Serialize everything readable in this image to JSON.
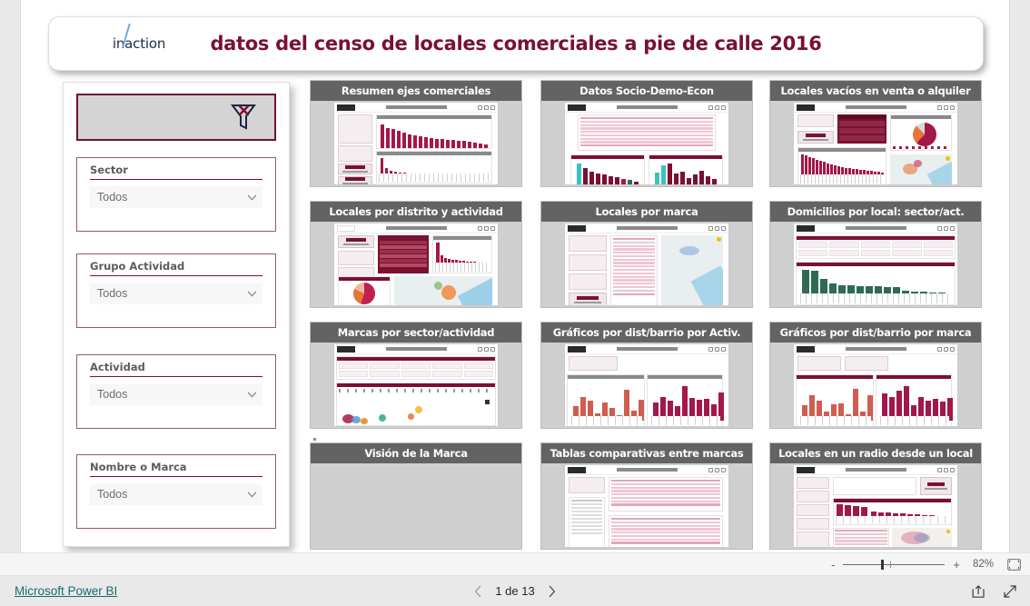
{
  "report": {
    "logo_text": "inaction",
    "title": "datos del censo de locales comerciales a pie de calle 2016",
    "accent_color": "#7b1030",
    "header_color": "#636363"
  },
  "filters": {
    "clear_button_label": "",
    "clear_icon": "funnel-clear-icon",
    "slicers": [
      {
        "label": "Sector",
        "value": "Todos",
        "icon": "chevron-down-icon"
      },
      {
        "label": "Grupo Actividad",
        "value": "Todos",
        "icon": "chevron-down-icon"
      },
      {
        "label": "Actividad",
        "value": "Todos",
        "icon": "chevron-down-icon"
      },
      {
        "label": "Nombre o Marca",
        "value": "Todos",
        "icon": "chevron-down-icon"
      }
    ]
  },
  "cards": [
    {
      "title": "Resumen ejes comerciales",
      "thumb": "bars-descending"
    },
    {
      "title": "Datos Socio-Demo-Econ",
      "thumb": "table-and-two-bar-charts"
    },
    {
      "title": "Locales vacíos en venta o alquiler",
      "thumb": "kpi-pie-bars-map"
    },
    {
      "title": "Locales por distrito y actividad",
      "thumb": "kpi-list-bars-pie-map"
    },
    {
      "title": "Locales por marca",
      "thumb": "slicers-list-map"
    },
    {
      "title": "Domicilios por local: sector/act.",
      "thumb": "green-bars"
    },
    {
      "title": "Marcas por sector/actividad",
      "thumb": "scatter-bubbles"
    },
    {
      "title": "Gráficos por dist/barrio por Activ.",
      "thumb": "two-bar-charts"
    },
    {
      "title": "Gráficos por dist/barrio por marca",
      "thumb": "two-bar-charts-alt"
    },
    {
      "title": "Visión de la Marca",
      "thumb": "empty"
    },
    {
      "title": "Tablas comparativas entre marcas",
      "thumb": "two-tables"
    },
    {
      "title": "Locales en un radio desde un local",
      "thumb": "slicers-bars-table-map"
    }
  ],
  "zoom_bar": {
    "minus_label": "-",
    "plus_label": "+",
    "percent": "82%",
    "fit_icon": "fit-to-page-icon"
  },
  "footer": {
    "powerbi_link": "Microsoft Power BI",
    "prev_icon": "chevron-left-icon",
    "next_icon": "chevron-right-icon",
    "page_label": "1 de 13",
    "share_icon": "share-icon",
    "fullscreen_icon": "fullscreen-icon"
  }
}
